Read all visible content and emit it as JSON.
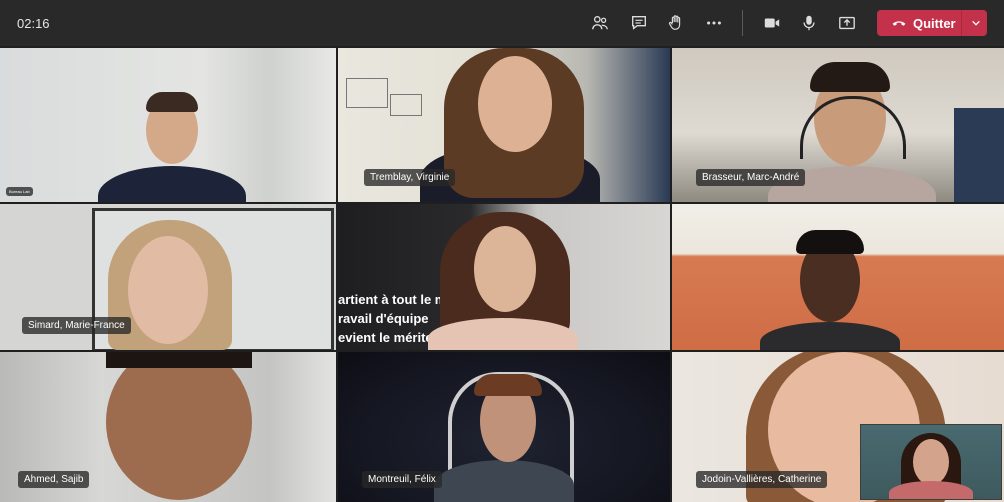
{
  "toolbar": {
    "timer": "02:16",
    "icons": [
      "people-icon",
      "chat-icon",
      "raise-hand-icon",
      "more-icon",
      "camera-icon",
      "mic-icon",
      "share-icon"
    ],
    "leave_label": "Quitter",
    "leave_color": "#c4314b"
  },
  "participants": [
    {
      "name": "Bureau Lab",
      "tag_size": "tiny"
    },
    {
      "name": "Tremblay, Virginie"
    },
    {
      "name": "Brasseur, Marc-André"
    },
    {
      "name": "Simard, Marie-France"
    },
    {
      "name": "",
      "background_text": "artient à tout le mo\nravail d'équipe\nevient le mérite. »"
    },
    {
      "name": "",
      "tag_size": "tiny"
    },
    {
      "name": "Ahmed, Sajib"
    },
    {
      "name": "Montreuil, Félix"
    },
    {
      "name": "Jodoin-Vallières, Catherine"
    }
  ],
  "self_view": {
    "label": ""
  }
}
